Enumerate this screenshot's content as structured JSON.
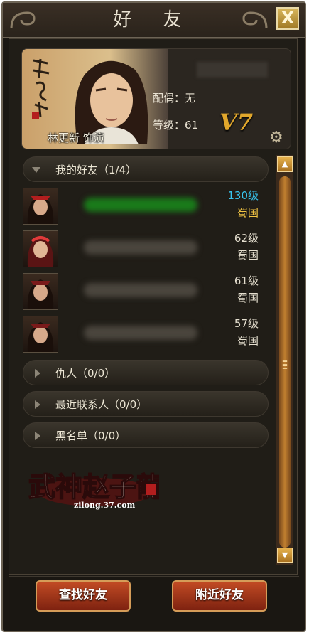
{
  "window": {
    "title": "好 友",
    "close_label": "X"
  },
  "profile": {
    "actor_caption": "林更新 饰演",
    "spouse_label": "配偶：无",
    "level_label": "等级：61",
    "vip_badge": "V7",
    "calligraphy": "赵子龙"
  },
  "groups": [
    {
      "label": "我的好友（1/4）",
      "expanded": true
    },
    {
      "label": "仇人（0/0）",
      "expanded": false
    },
    {
      "label": "最近联系人（0/0）",
      "expanded": false
    },
    {
      "label": "黑名单（0/0）",
      "expanded": false
    }
  ],
  "friends": [
    {
      "level": "130级",
      "faction": "蜀国",
      "level_color": "#38c5ef",
      "faction_color": "#f2c544",
      "name_color": "#1a7a1a"
    },
    {
      "level": "62级",
      "faction": "蜀国",
      "level_color": "#e5dfcf",
      "faction_color": "#e5dfcf",
      "name_color": "#4a453d"
    },
    {
      "level": "61级",
      "faction": "蜀国",
      "level_color": "#e5dfcf",
      "faction_color": "#e5dfcf",
      "name_color": "#4a453d"
    },
    {
      "level": "57级",
      "faction": "蜀国",
      "level_color": "#e5dfcf",
      "faction_color": "#e5dfcf",
      "name_color": "#4a453d"
    }
  ],
  "logo": {
    "text": "武神赵子龍",
    "url": "zilong.37.com"
  },
  "buttons": {
    "find_friend": "查找好友",
    "nearby_friend": "附近好友"
  },
  "colors": {
    "accent_gold": "#e1a72c",
    "button_red": "#a9361a",
    "panel_bg": "#201d17"
  }
}
